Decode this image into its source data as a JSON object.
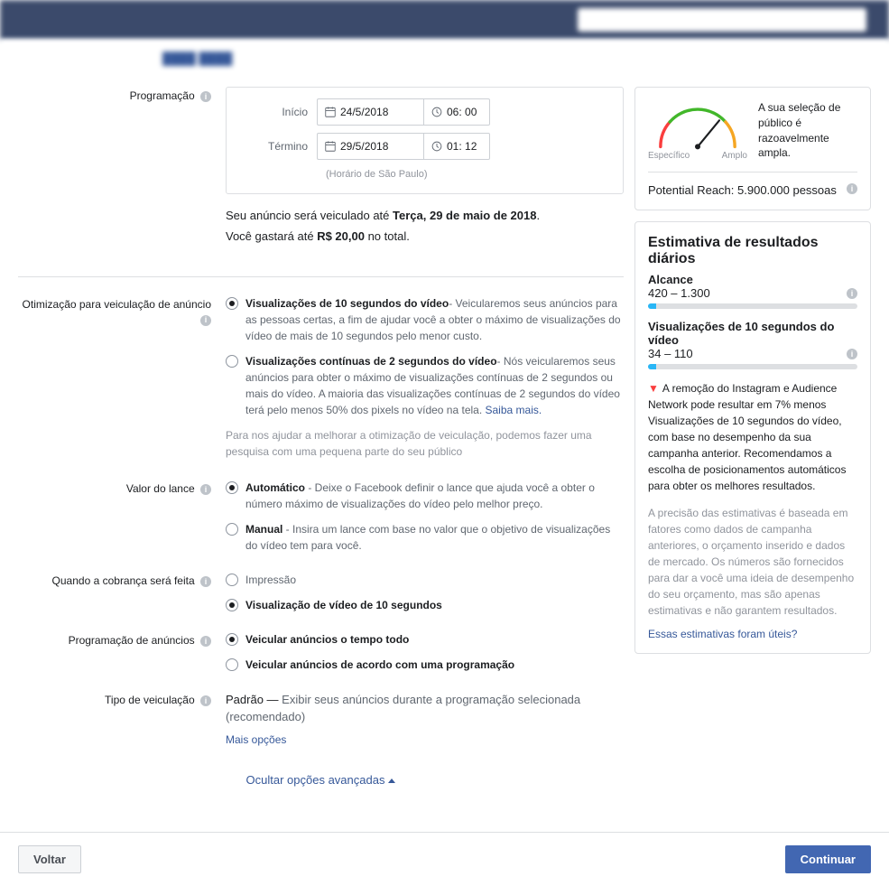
{
  "schedule": {
    "section_label": "Programação",
    "start_label": "Início",
    "end_label": "Término",
    "start_date": "24/5/2018",
    "start_time": "06: 00",
    "end_date": "29/5/2018",
    "end_time": "01: 12",
    "tz": "(Horário de São Paulo)",
    "run_prefix": "Seu anúncio será veiculado até ",
    "run_bold": "Terça, 29 de maio de 2018",
    "run_suffix": ".",
    "spend_prefix": "Você gastará até ",
    "spend_bold": "R$ 20,00",
    "spend_suffix": " no total."
  },
  "optimization": {
    "section_label": "Otimização para veiculação de anúncio",
    "opt1_title": "Visualizações de 10 segundos do vídeo",
    "opt1_desc": "- Veicularemos seus anúncios para as pessoas certas, a fim de ajudar você a obter o máximo de visualizações do vídeo de mais de 10 segundos pelo menor custo.",
    "opt2_title": "Visualizações contínuas de 2 segundos do vídeo",
    "opt2_desc": "- Nós veicularemos seus anúncios para obter o máximo de visualizações contínuas de 2 segundos ou mais do vídeo. A maioria das visualizações contínuas de 2 segundos do vídeo terá pelo menos 50% dos pixels no vídeo na tela. ",
    "learn_more": "Saiba mais.",
    "helper": "Para nos ajudar a melhorar a otimização de veiculação, podemos fazer uma pesquisa com uma pequena parte do seu público"
  },
  "bid": {
    "section_label": "Valor do lance",
    "auto_title": "Automático",
    "auto_desc": " - Deixe o Facebook definir o lance que ajuda você a obter o número máximo de visualizações do vídeo pelo melhor preço.",
    "manual_title": "Manual",
    "manual_desc": " - Insira um lance com base no valor que o objetivo de visualizações do vídeo tem para você."
  },
  "charge": {
    "section_label": "Quando a cobrança será feita",
    "opt1": "Impressão",
    "opt2": "Visualização de vídeo de 10 segundos"
  },
  "scheduling": {
    "section_label": "Programação de anúncios",
    "opt1": "Veicular anúncios o tempo todo",
    "opt2": "Veicular anúncios de acordo com uma programação"
  },
  "delivery": {
    "section_label": "Tipo de veiculação",
    "prefix": "Padrão — ",
    "desc": "Exibir seus anúncios durante a programação selecionada (recomendado)",
    "more": "Mais opções"
  },
  "hide_advanced": "Ocultar opções avançadas",
  "footer": {
    "back": "Voltar",
    "continue": "Continuar"
  },
  "audiencePanel": {
    "specific": "Específico",
    "broad": "Amplo",
    "message": "A sua seleção de público é razoavelmente ampla.",
    "reach_label": "Potential Reach: ",
    "reach_value": "5.900.000 pessoas"
  },
  "estimates": {
    "title": "Estimativa de resultados diários",
    "reach_label": "Alcance",
    "reach_range": "420 – 1.300",
    "views_label": "Visualizações de 10 segundos do vídeo",
    "views_range": "34 – 110",
    "warning": "A remoção do Instagram e Audience Network pode resultar em 7% menos Visualizações de 10 segundos do vídeo, com base no desempenho da sua campanha anterior. Recomendamos a escolha de posicionamentos automáticos para obter os melhores resultados.",
    "disclaimer": "A precisão das estimativas é baseada em fatores como dados de campanha anteriores, o orçamento inserido e dados de mercado. Os números são fornecidos para dar a você uma ideia de desempenho do seu orçamento, mas são apenas estimativas e não garantem resultados.",
    "feedback": "Essas estimativas foram úteis?"
  }
}
